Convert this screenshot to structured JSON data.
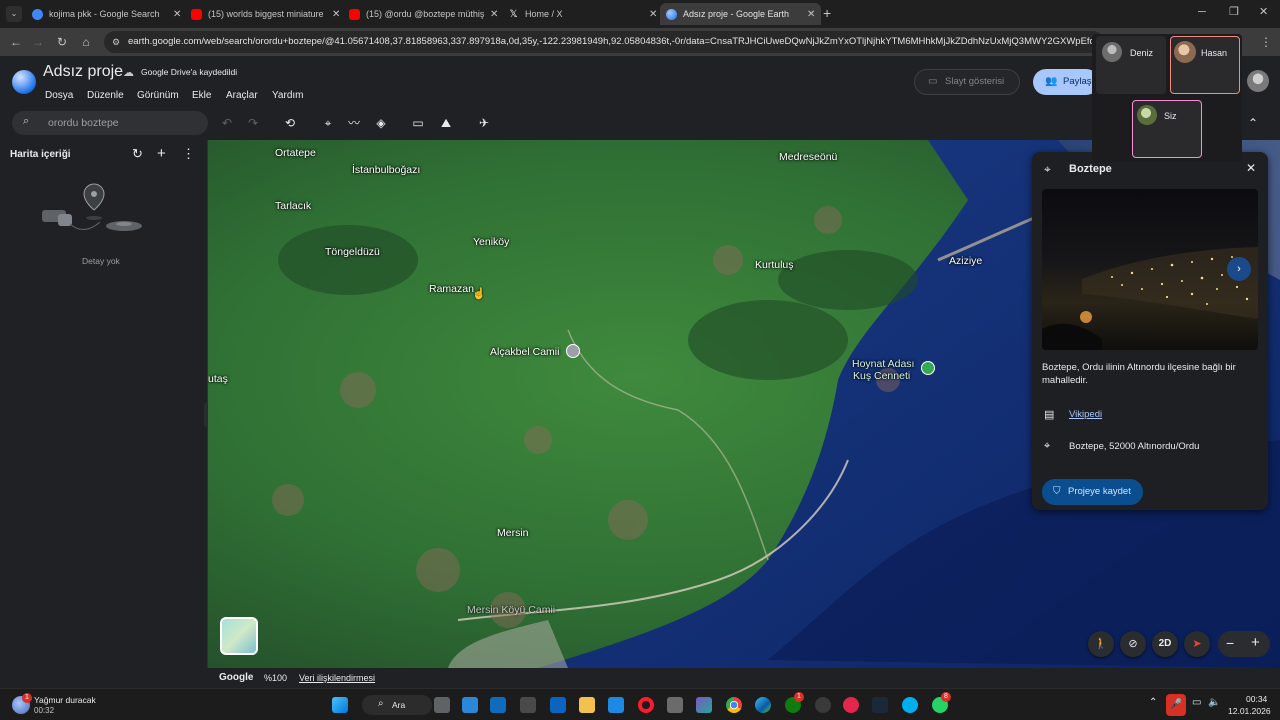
{
  "browser": {
    "tabs": [
      {
        "title": "kojima pkk - Google Search",
        "color": "#4285f4"
      },
      {
        "title": "(15) worlds biggest miniature t",
        "color": "#ff0000"
      },
      {
        "title": "(15) @ordu @boztepe müthiş",
        "color": "#ff0000"
      },
      {
        "title": "Home / X",
        "color": "#ffffff"
      },
      {
        "title": "Adsız proje - Google Earth",
        "color": "#4c8bf5"
      }
    ],
    "url": "earth.google.com/web/search/orordu+boztepe/@41.05671408,37.81858963,337.897918a,0d,35y,-122.23981949h,92.05804836t,-0r/data=CnsaTRJHCiUweDQwNjJkZmYxOTljNjhkYTM6MHhkMjJkZDdhNzUxMjQ3MWY2GXWpEfqZgERAIc"
  },
  "earth": {
    "project_title": "Adsız proje",
    "drive_status": "Google Drive'a kaydedildi",
    "menu": [
      "Dosya",
      "Düzenle",
      "Görünüm",
      "Ekle",
      "Araçlar",
      "Yardım"
    ],
    "search_value": "orordu boztepe",
    "slideshow_label": "Slayt gösterisi",
    "share_label": "Paylaş",
    "sidebar_title": "Harita içeriği",
    "sidebar_empty": "Detay yok"
  },
  "presence": {
    "users": [
      {
        "name": "Deniz"
      },
      {
        "name": "Hasan"
      },
      {
        "name": "Siz"
      }
    ]
  },
  "map": {
    "places": [
      {
        "name": "Ortatepe"
      },
      {
        "name": "İstanbulboğazı"
      },
      {
        "name": "Medreseönü"
      },
      {
        "name": "Tarlacık"
      },
      {
        "name": "Töngeldüzü"
      },
      {
        "name": "Yeniköy"
      },
      {
        "name": "Kurtuluş"
      },
      {
        "name": "Aziziye"
      },
      {
        "name": "Ramazan"
      },
      {
        "name": "Alçakbel Camii"
      },
      {
        "name": "Hoynat Adası"
      },
      {
        "name": "Kuş Cenneti"
      },
      {
        "name": "utaş"
      },
      {
        "name": "Mersin"
      },
      {
        "name": "Mersin Köyü Camii"
      }
    ]
  },
  "info_panel": {
    "title": "Boztepe",
    "description": "Boztepe, Ordu ilinin Altınordu ilçesine bağlı bir mahalledir.",
    "link_label": "Vikipedi",
    "address": "Boztepe, 52000 Altınordu/Ordu",
    "save_label": "Projeye kaydet"
  },
  "controls": {
    "mode_2d": "2D"
  },
  "status": {
    "brand": "Google",
    "zoom": "%100",
    "attribution": "Veri ilişkilendirmesi"
  },
  "taskbar": {
    "weather_title": "Yağmur duracak",
    "weather_time": "00:32",
    "search_label": "Ara",
    "clock_time": "00:34",
    "clock_date": "12.01.2026",
    "badge_1": "1",
    "badge_2": "8"
  }
}
